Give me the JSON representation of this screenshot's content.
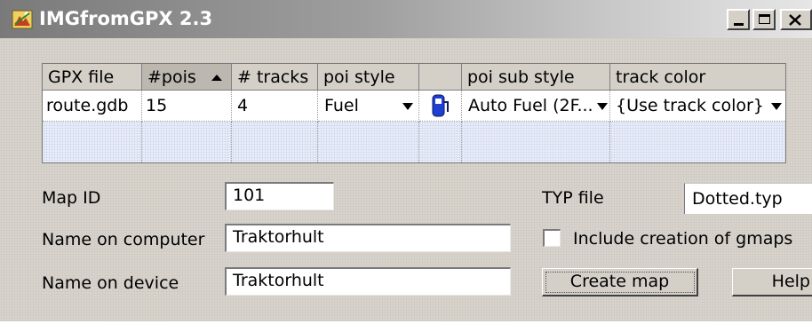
{
  "window": {
    "title": "IMGfromGPX 2.3",
    "controls": {
      "minimize": "_",
      "maximize": "□",
      "close": "×"
    }
  },
  "grid": {
    "columns": [
      "GPX file",
      "#pois",
      "# tracks",
      "poi style",
      "",
      "poi sub style",
      "track color"
    ],
    "sorted_column": "#pois",
    "rows": [
      {
        "gpx_file": "route.gdb",
        "pois": "15",
        "tracks": "4",
        "poi_style": "Fuel",
        "poi_icon": "fuel-pump-icon",
        "poi_sub_style": "Auto Fuel (2F...",
        "track_color": "{Use track color}"
      }
    ]
  },
  "form": {
    "map_id_label": "Map ID",
    "map_id_value": "101",
    "name_computer_label": "Name on computer",
    "name_computer_value": "Traktorhult",
    "name_device_label": "Name on device",
    "name_device_value": "Traktorhult",
    "typ_file_label": "TYP file",
    "typ_file_value": "Dotted.typ",
    "include_gmapsupp_label": "Include creation of gmaps",
    "include_gmapsupp_checked": false
  },
  "buttons": {
    "create_map": "Create map",
    "help": "Help"
  },
  "colors": {
    "window_bg": "#d8d4cc",
    "fuel_icon": "#1f3fd0",
    "alt_row": "#e9eef9"
  }
}
